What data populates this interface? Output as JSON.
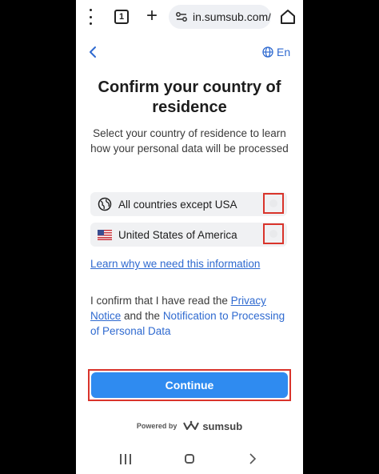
{
  "browser": {
    "tabs_count": "1",
    "url": "in.sumsub.com/w",
    "icons": [
      "more-vert-icon",
      "tabs-icon",
      "plus-icon",
      "site-settings-icon",
      "home-icon"
    ]
  },
  "header": {
    "language_label": "En"
  },
  "main": {
    "title": "Confirm your country of residence",
    "subtitle": "Select your country of residence to learn how your personal data will be processed",
    "options": [
      {
        "label": "All countries except USA",
        "icon": "globe-icon"
      },
      {
        "label": "United States of America",
        "icon": "us-flag-icon"
      }
    ],
    "learn_link": "Learn why we need this information",
    "confirm": {
      "prefix": "I confirm that I have read the ",
      "privacy_link": "Privacy Notice",
      "middle": " and the ",
      "notification_link": "Notification to Processing of Personal Data"
    },
    "continue_label": "Continue"
  },
  "footer": {
    "powered_by": "Powered by",
    "brand": "sumsub"
  },
  "colors": {
    "accent": "#2f8bf0",
    "link": "#2f6ad0",
    "highlight": "#d9342b"
  }
}
